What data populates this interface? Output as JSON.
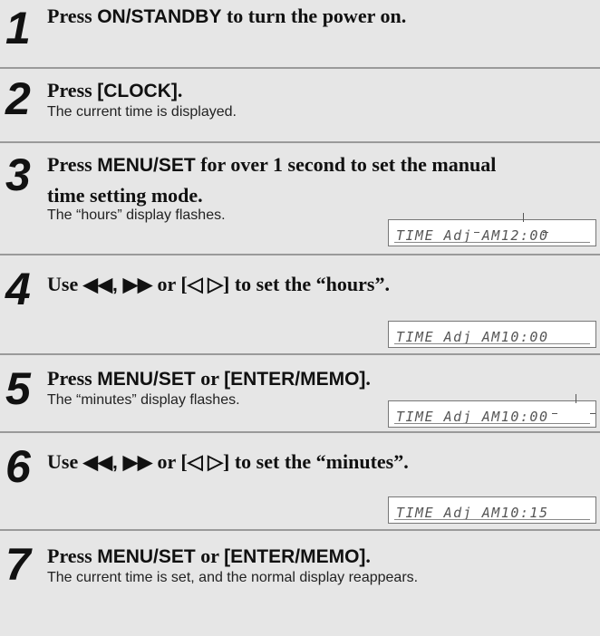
{
  "steps": [
    {
      "num": "1",
      "title_parts": [
        "Press ",
        "ON/STANDBY",
        " to turn the power on."
      ],
      "desc": ""
    },
    {
      "num": "2",
      "title_parts": [
        "Press ",
        "[CLOCK]",
        "."
      ],
      "desc": "The current time is displayed."
    },
    {
      "num": "3",
      "title_parts": [
        "Press ",
        "MENU/SET",
        " for over 1 second to set the manual"
      ],
      "title_line2": "time setting mode.",
      "desc": "The “hours” display flashes.",
      "lcd": "TIME Adj AM12:00"
    },
    {
      "num": "4",
      "title_parts": [
        "Use ",
        "◀◀, ▶▶",
        " or [◁ ▷] to set the “hours”."
      ],
      "desc": "",
      "lcd": "TIME Adj AM10:00"
    },
    {
      "num": "5",
      "title_parts": [
        "Press ",
        "MENU/SET",
        " or ",
        "[ENTER/MEMO]",
        "."
      ],
      "desc": "The “minutes” display flashes.",
      "lcd": "TIME Adj AM10:00"
    },
    {
      "num": "6",
      "title_parts": [
        "Use ",
        "◀◀, ▶▶",
        " or [◁ ▷] to set the “minutes”."
      ],
      "desc": "",
      "lcd": "TIME Adj AM10:15"
    },
    {
      "num": "7",
      "title_parts": [
        "Press ",
        "MENU/SET",
        " or ",
        "[ENTER/MEMO]",
        "."
      ],
      "desc": "The current time is set, and the normal display reappears."
    }
  ]
}
